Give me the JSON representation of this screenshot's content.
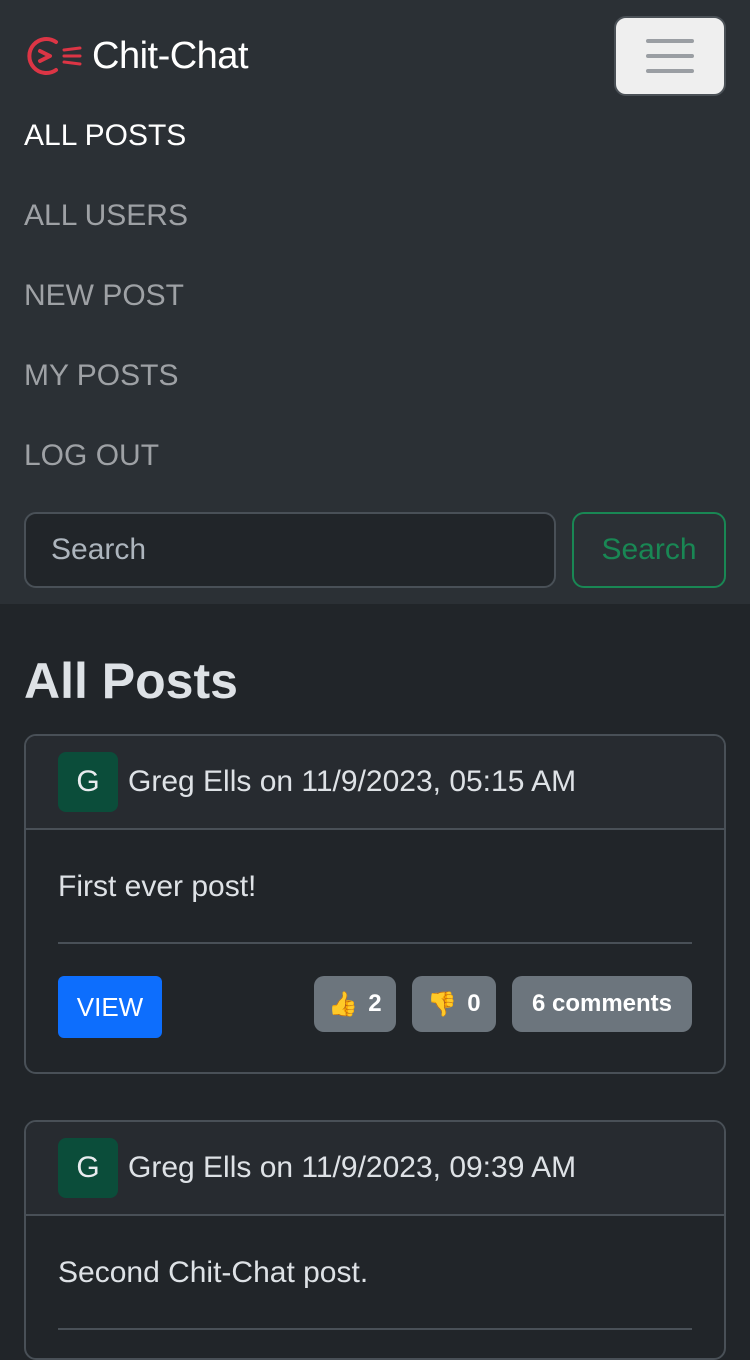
{
  "brand": {
    "name": "Chit-Chat",
    "logo_icon": "chat-logo-icon",
    "accent": "#dc3545"
  },
  "nav": {
    "items": [
      {
        "label": "ALL POSTS",
        "active": true
      },
      {
        "label": "ALL USERS",
        "active": false
      },
      {
        "label": "NEW POST",
        "active": false
      },
      {
        "label": "MY POSTS",
        "active": false
      },
      {
        "label": "LOG OUT",
        "active": false
      }
    ],
    "toggler_icon": "hamburger-menu-icon"
  },
  "search": {
    "placeholder": "Search",
    "button_label": "Search"
  },
  "page": {
    "title": "All Posts"
  },
  "posts": [
    {
      "avatar": "G",
      "meta": "Greg Ells on 11/9/2023, 05:15 AM",
      "text": "First ever post!",
      "view_label": "VIEW",
      "likes": "2",
      "dislikes": "0",
      "comments": "6 comments"
    },
    {
      "avatar": "G",
      "meta": "Greg Ells on 11/9/2023, 09:39 AM",
      "text": "Second Chit-Chat post."
    }
  ],
  "colors": {
    "navbar_bg": "#2b3035",
    "page_bg": "#212529",
    "primary": "#0d6efd",
    "success": "#198754",
    "badge": "#6c757d",
    "avatar_bg": "#0b4d3a"
  }
}
